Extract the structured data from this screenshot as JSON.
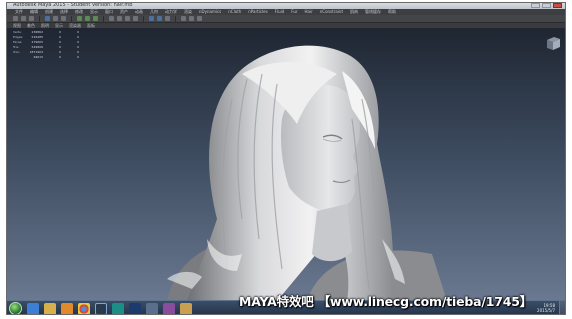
{
  "window": {
    "title": "Autodesk Maya 2015 - Student Version: hair.mb"
  },
  "menu_bar": {
    "items": [
      "文件",
      "编辑",
      "创建",
      "选择",
      "修改",
      "显示",
      "窗口",
      "资产",
      "动画",
      "几何",
      "动力学",
      "渲染",
      "nDynamics",
      "nCloth",
      "nParticles",
      "Fluid",
      "Fur",
      "Hair",
      "nConstraint",
      "肌肉",
      "管线缓存",
      "帮助"
    ]
  },
  "panel_menu": {
    "items": [
      "视图",
      "着色",
      "照明",
      "显示",
      "渲染器",
      "面板"
    ]
  },
  "hud": {
    "rows": [
      {
        "label": "Verts:",
        "value": "236862",
        "c2": "0",
        "c3": "0"
      },
      {
        "label": "Edges:",
        "value": "516485",
        "c2": "0",
        "c3": "0"
      },
      {
        "label": "Faces:",
        "value": "279605",
        "c2": "0",
        "c3": "0"
      },
      {
        "label": "Tris:",
        "value": "549806",
        "c2": "0",
        "c3": "0"
      },
      {
        "label": "UVs:",
        "value": "1871903",
        "c2": "0",
        "c3": "0"
      },
      {
        "label": "",
        "value": "49615",
        "c2": "0",
        "c3": "0"
      }
    ]
  },
  "taskbar": {
    "icons": [
      "start-orb",
      "browser-icon",
      "explorer-icon",
      "media-player-icon",
      "chrome-icon",
      "qq-icon",
      "maya-icon",
      "photoshop-icon",
      "app-icon",
      "app-icon-2",
      "folder-icon"
    ],
    "clock_time": "19:58",
    "clock_date": "2015/5/7"
  },
  "watermark": {
    "text": "MAYA特效吧 【www.linecg.com/tieba/1745】"
  },
  "colors": {
    "viewport_top": "#1f2632",
    "viewport_bottom": "#6a7890",
    "taskbar": "#22324a"
  }
}
